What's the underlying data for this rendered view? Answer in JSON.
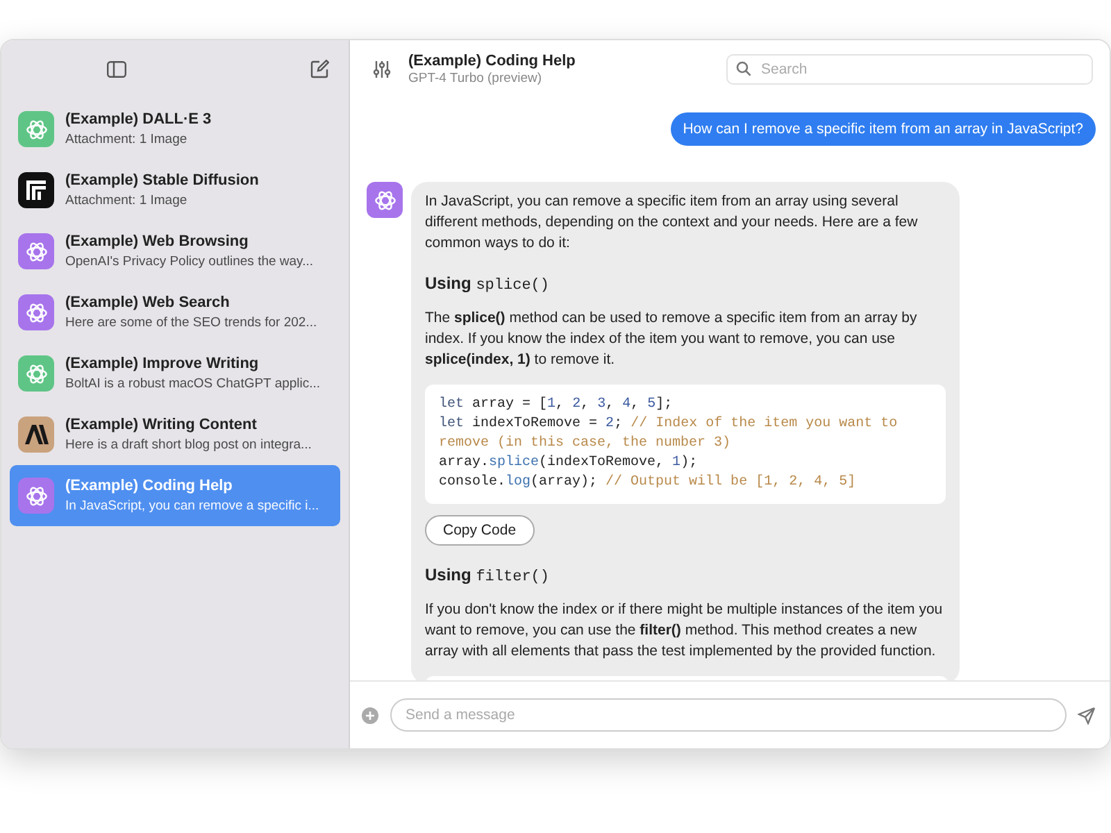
{
  "sidebar": {
    "items": [
      {
        "title": "(Example) DALL·E 3",
        "subtitle": "Attachment: 1 Image",
        "kind": "knot",
        "color": "#5fc586",
        "selected": false
      },
      {
        "title": "(Example) Stable Diffusion",
        "subtitle": "Attachment: 1 Image",
        "kind": "frame",
        "color": "#111111",
        "selected": false
      },
      {
        "title": "(Example) Web Browsing",
        "subtitle": "OpenAI's Privacy Policy outlines the way...",
        "kind": "knot",
        "color": "#a774ec",
        "selected": false
      },
      {
        "title": "(Example) Web Search",
        "subtitle": "Here are some of the SEO trends for 202...",
        "kind": "knot",
        "color": "#a774ec",
        "selected": false
      },
      {
        "title": "(Example) Improve Writing",
        "subtitle": "BoltAI is a robust macOS ChatGPT applic...",
        "kind": "knot",
        "color": "#5fc586",
        "selected": false
      },
      {
        "title": "(Example) Writing Content",
        "subtitle": "Here is a draft short blog post on integra...",
        "kind": "slash",
        "color": "#c9a27e",
        "selected": false
      },
      {
        "title": "(Example) Coding Help",
        "subtitle": "In JavaScript, you can remove a specific i...",
        "kind": "knot",
        "color": "#a774ec",
        "selected": true
      }
    ]
  },
  "header": {
    "title": "(Example) Coding Help",
    "subtitle": "GPT-4 Turbo (preview)",
    "search": {
      "placeholder": "Search"
    }
  },
  "messages": [
    {
      "kind": "user",
      "text": "How can I remove a specific item from an array in JavaScript?"
    },
    {
      "kind": "assistant",
      "blocks": [
        {
          "kind": "paragraph",
          "text": "In JavaScript, you can remove a specific item from an array using several different methods, depending on the context and your needs. Here are a few common ways to do it:"
        },
        {
          "kind": "heading",
          "text": "Using",
          "code": "splice()"
        },
        {
          "kind": "paragraph",
          "text": "The **splice()** method can be used to remove a specific item from an array by index. If you know the index of the item you want to remove, you can use **splice(index, 1)** to remove it."
        },
        {
          "kind": "code",
          "lines": [
            [
              {
                "text": "let",
                "kind": "kw"
              },
              {
                "text": " array = [",
                "kind": "plain"
              },
              {
                "text": "1",
                "kind": "num"
              },
              {
                "text": ", ",
                "kind": "plain"
              },
              {
                "text": "2",
                "kind": "num"
              },
              {
                "text": ", ",
                "kind": "plain"
              },
              {
                "text": "3",
                "kind": "num"
              },
              {
                "text": ", ",
                "kind": "plain"
              },
              {
                "text": "4",
                "kind": "num"
              },
              {
                "text": ", ",
                "kind": "plain"
              },
              {
                "text": "5",
                "kind": "num"
              },
              {
                "text": "];",
                "kind": "plain"
              }
            ],
            [
              {
                "text": "let",
                "kind": "kw"
              },
              {
                "text": " indexToRemove = ",
                "kind": "plain"
              },
              {
                "text": "2",
                "kind": "num"
              },
              {
                "text": "; ",
                "kind": "plain"
              },
              {
                "text": "// Index of the item you want to",
                "kind": "comment"
              }
            ],
            [
              {
                "text": "remove (in this case, the number 3)",
                "kind": "comment"
              }
            ],
            [
              {
                "text": "array.",
                "kind": "plain"
              },
              {
                "text": "splice",
                "kind": "fn"
              },
              {
                "text": "(indexToRemove, ",
                "kind": "plain"
              },
              {
                "text": "1",
                "kind": "num"
              },
              {
                "text": ");",
                "kind": "plain"
              }
            ],
            [
              {
                "text": "console.",
                "kind": "plain"
              },
              {
                "text": "log",
                "kind": "fn"
              },
              {
                "text": "(array); ",
                "kind": "plain"
              },
              {
                "text": "// Output will be [1, 2, 4, 5]",
                "kind": "comment"
              }
            ]
          ]
        },
        {
          "kind": "button",
          "text": "Copy Code"
        },
        {
          "kind": "heading",
          "text": "Using",
          "code": "filter()"
        },
        {
          "kind": "paragraph",
          "text": "If you don't know the index or if there might be multiple instances of the item you want to remove, you can use the **filter()** method. This method creates a new array with all elements that pass the test implemented by the provided function."
        },
        {
          "kind": "code_edge"
        }
      ]
    }
  ],
  "composer": {
    "placeholder": "Send a message"
  }
}
